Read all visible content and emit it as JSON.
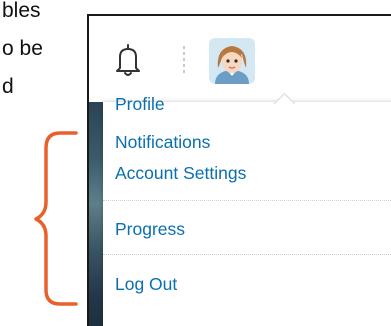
{
  "background_text": {
    "line1": "bles",
    "line2": "o be",
    "line3": "d"
  },
  "topbar": {
    "icons": [
      "bell-icon",
      "avatar"
    ]
  },
  "menu": {
    "items": [
      {
        "label": "Profile"
      },
      {
        "label": "Notifications"
      },
      {
        "label": "Account Settings"
      },
      {
        "label": "Progress"
      },
      {
        "label": "Log Out"
      }
    ]
  },
  "colors": {
    "link": "#0a6fae",
    "bracket": "#e8612c",
    "panel_border": "#1a1a1a"
  }
}
